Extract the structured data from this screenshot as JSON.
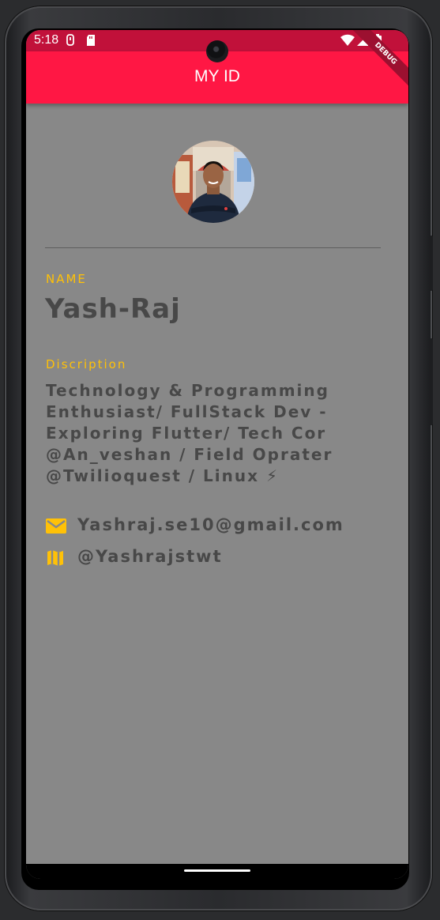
{
  "status_bar": {
    "time": "5:18",
    "icons": [
      "usb-icon",
      "sd-card-icon",
      "wifi-icon",
      "signal-icon",
      "battery-icon"
    ]
  },
  "app_bar": {
    "title": "MY ID",
    "color": "#ff1744"
  },
  "debug_banner": "DEBUG",
  "profile": {
    "name_label": "NAME",
    "name": "Yash-Raj",
    "description_label": "Discription",
    "description": "Technology & Programming\nEnthusiast/ FullStack Dev -\nExploring Flutter/ Tech Cor\n@An_veshan / Field Oprater\n@Twilioquest / Linux ⚡",
    "email": "Yashraj.se10@gmail.com",
    "social": "@Yashrajstwt"
  },
  "colors": {
    "background": "#888888",
    "accent": "#ffc107",
    "text": "#484848",
    "status_bar": "#c1113a"
  }
}
